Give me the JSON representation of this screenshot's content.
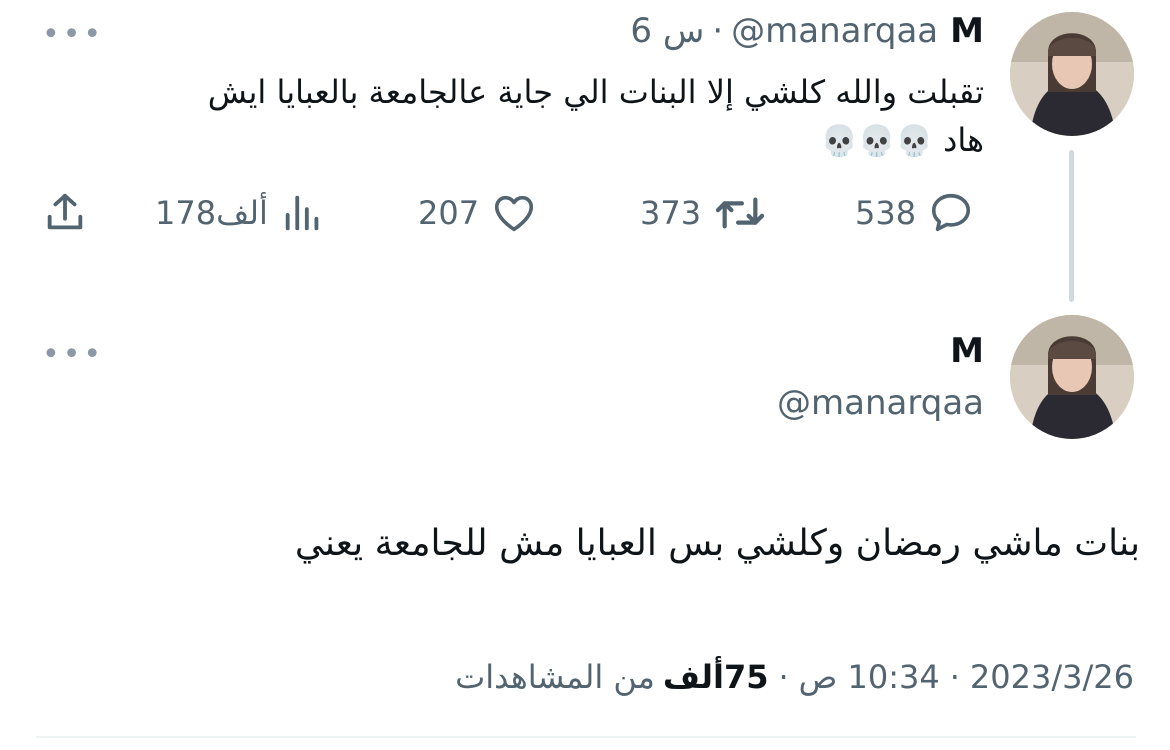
{
  "tweet1": {
    "name": "M",
    "handle": "@manarqaa",
    "separator": "·",
    "time": "6 س",
    "text_line1": "تقبلت والله كلشي إلا البنات الي جاية عالجامعة بالعبايا ايش",
    "text_line2": "هاد",
    "emoji": "💀💀💀",
    "replies": "538",
    "retweets": "373",
    "likes": "207",
    "views": "178ألف"
  },
  "tweet2": {
    "name": "M",
    "handle": "@manarqaa",
    "text": "بنات ماشي رمضان وكلشي بس العبايا مش للجامعة يعني",
    "date": "2023/3/26",
    "sep1": "·",
    "time": "10:34 ص",
    "sep2": "·",
    "views_count": "75ألف",
    "views_label": "من المشاهدات"
  },
  "icons": {
    "more": "more-dots-icon",
    "share": "share-icon",
    "views": "views-chart-icon",
    "like": "heart-icon",
    "retweet": "retweet-icon",
    "reply": "reply-bubble-icon"
  },
  "colors": {
    "text": "#0f1419",
    "muted": "#536471",
    "thread_line": "#cfd9de",
    "divider": "#eff3f4"
  }
}
